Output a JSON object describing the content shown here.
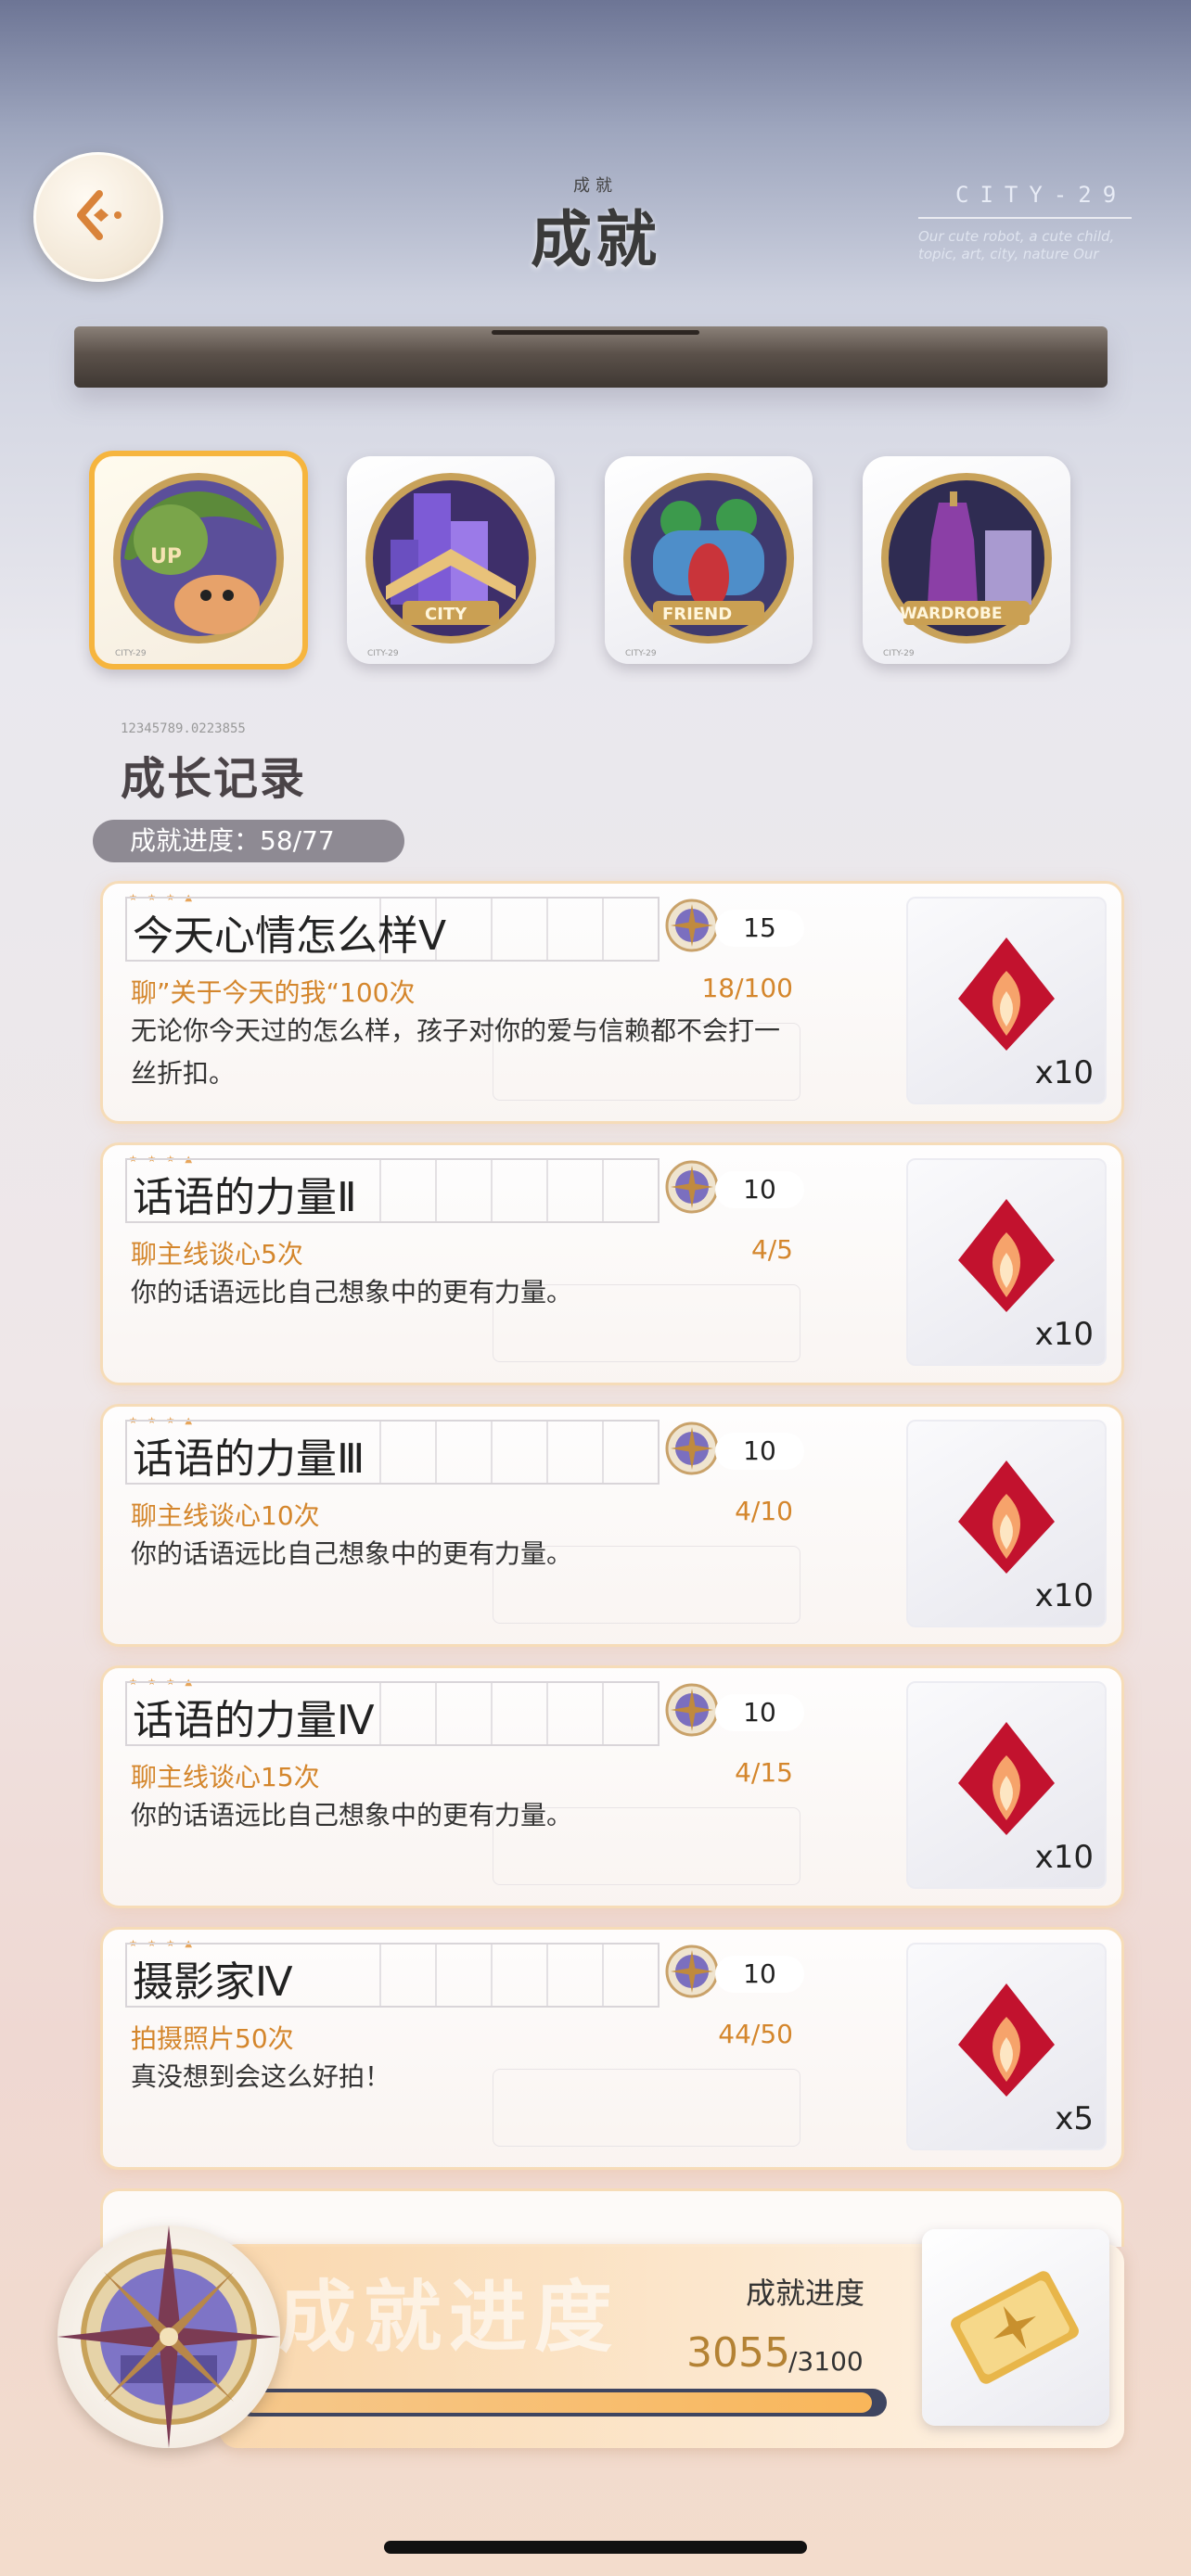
{
  "header": {
    "title": "成就",
    "title_small": "成就",
    "brand": "CITY-29",
    "brand_sub": "Our cute robot, a cute child, topic, art, city, nature Our"
  },
  "badges": [
    {
      "label": "UP",
      "foot": "CITY-29"
    },
    {
      "label": "CITY",
      "foot": "CITY-29"
    },
    {
      "label": "FRIEND",
      "foot": "CITY-29"
    },
    {
      "label": "WARDROBE",
      "foot": "CITY-29"
    }
  ],
  "section": {
    "code": "12345789.0223855",
    "title": "成长记录",
    "progress": "成就进度：58/77"
  },
  "cards": [
    {
      "name": "今天心情怎么样Ⅴ",
      "points": "15",
      "condition": "聊”关于今天的我“100次",
      "count": "18/100",
      "desc": "无论你今天过的怎么样，孩子对你的爱与信赖都不会打一丝折扣。",
      "reward_count": "x10"
    },
    {
      "name": "话语的力量Ⅱ",
      "points": "10",
      "condition": "聊主线谈心5次",
      "count": "4/5",
      "desc": "你的话语远比自己想象中的更有力量。",
      "reward_count": "x10"
    },
    {
      "name": "话语的力量Ⅲ",
      "points": "10",
      "condition": "聊主线谈心10次",
      "count": "4/10",
      "desc": "你的话语远比自己想象中的更有力量。",
      "reward_count": "x10"
    },
    {
      "name": "话语的力量Ⅳ",
      "points": "10",
      "condition": "聊主线谈心15次",
      "count": "4/15",
      "desc": "你的话语远比自己想象中的更有力量。",
      "reward_count": "x10"
    },
    {
      "name": "摄影家Ⅳ",
      "points": "10",
      "condition": "拍摄照片50次",
      "count": "44/50",
      "desc": "真没想到会这么好拍！",
      "reward_count": "x5"
    }
  ],
  "bottom": {
    "watermark": "成就进度",
    "label": "成就进度",
    "value": "3055",
    "max": "/3100",
    "progress_fraction": 0.985
  },
  "icons": {
    "back": "back-arrow-icon",
    "coin": "compass-coin-icon",
    "reward": "red-crystal-icon",
    "ticket": "gold-ticket-icon"
  }
}
